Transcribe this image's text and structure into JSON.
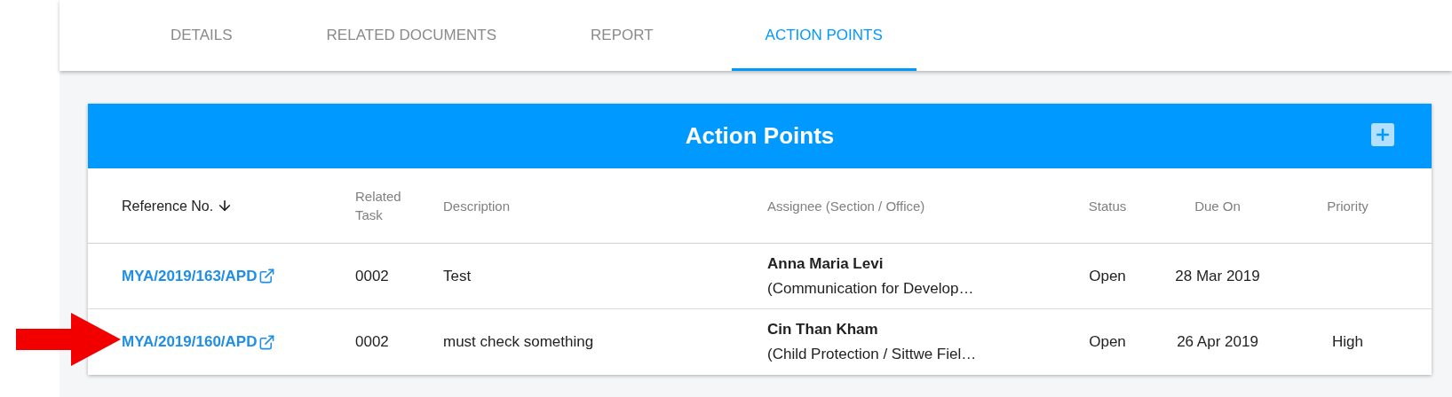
{
  "tabs": [
    {
      "label": "DETAILS",
      "selected": false
    },
    {
      "label": "RELATED DOCUMENTS",
      "selected": false
    },
    {
      "label": "REPORT",
      "selected": false
    },
    {
      "label": "ACTION POINTS",
      "selected": true
    }
  ],
  "action_points": {
    "title": "Action Points",
    "columns": [
      {
        "label": "Reference No.",
        "sorted": true
      },
      {
        "label": "Related Task",
        "sorted": false
      },
      {
        "label": "Description",
        "sorted": false
      },
      {
        "label": "Assignee (Section / Office)",
        "sorted": false
      },
      {
        "label": "Status",
        "sorted": false
      },
      {
        "label": "Due On",
        "sorted": false
      },
      {
        "label": "Priority",
        "sorted": false
      }
    ],
    "rows": [
      {
        "reference": "MYA/2019/163/APD",
        "related_task": "0002",
        "description": "Test",
        "assignee": "Anna Maria Levi",
        "section": "(Communication for Develop…",
        "status": "Open",
        "due_on": "28 Mar 2019"
      },
      {
        "reference": "MYA/2019/160/APD",
        "related_task": "0002",
        "description": "must check something",
        "assignee": "Cin Than Kham",
        "section": "(Child Protection / Sittwe Fiel…",
        "status": "Open",
        "due_on": "26 Apr 2019",
        "priority": "High"
      }
    ]
  }
}
